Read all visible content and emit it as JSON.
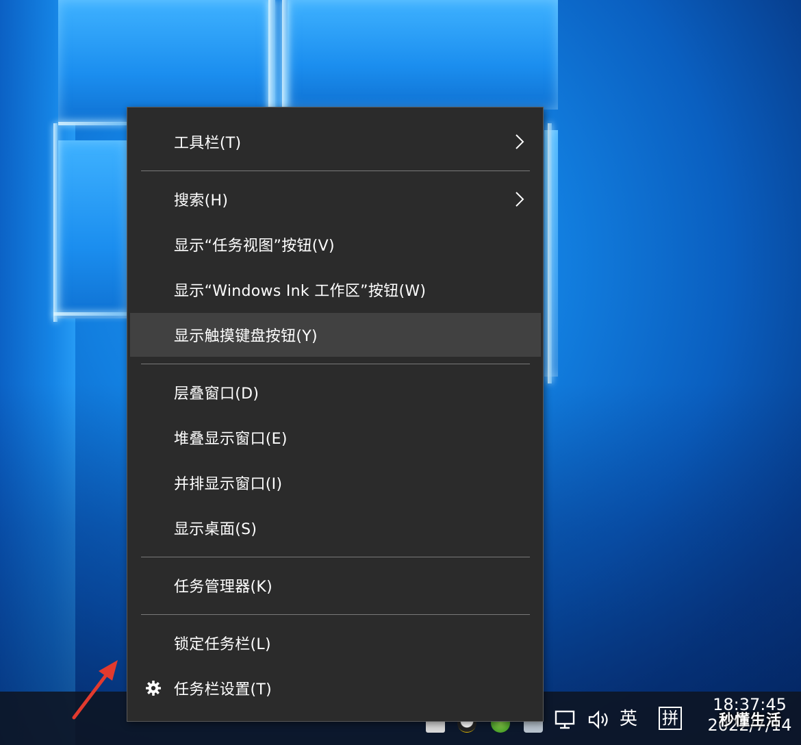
{
  "context_menu": {
    "items": [
      {
        "label": "工具栏(T)",
        "submenu": true
      },
      {
        "label": "搜索(H)",
        "submenu": true
      },
      {
        "label": "显示“任务视图”按钮(V)"
      },
      {
        "label": "显示“Windows Ink 工作区”按钮(W)"
      },
      {
        "label": "显示触摸键盘按钮(Y)",
        "hovered": true
      },
      {
        "label": "层叠窗口(D)"
      },
      {
        "label": "堆叠显示窗口(E)"
      },
      {
        "label": "并排显示窗口(I)"
      },
      {
        "label": "显示桌面(S)"
      },
      {
        "label": "任务管理器(K)"
      },
      {
        "label": "锁定任务栏(L)"
      },
      {
        "label": "任务栏设置(T)",
        "icon": "gear-icon"
      }
    ]
  },
  "taskbar": {
    "tray": {
      "input_lang": "英",
      "ime_mode": "拼",
      "network_icon": "network-icon",
      "volume_icon": "volume-icon"
    },
    "clock": {
      "time": "18:37:45",
      "date": "2022/7/14"
    }
  },
  "watermark": {
    "text": "秒懂生活"
  },
  "colors": {
    "menu_bg": "#2b2b2b",
    "menu_hover": "#414141",
    "separator": "#7a7a7a",
    "arrow": "#e23a2e"
  }
}
